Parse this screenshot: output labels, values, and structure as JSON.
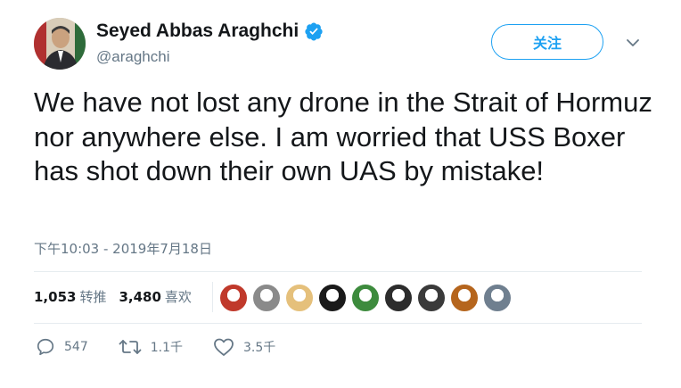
{
  "user": {
    "display_name": "Seyed Abbas Araghchi",
    "handle": "@araghchi",
    "verified": true
  },
  "header": {
    "follow_label": "关注"
  },
  "tweet": {
    "text": "We have not lost any drone in the Strait of Hormuz nor anywhere else. I am worried that USS Boxer has shot down their own UAS by mistake!",
    "timestamp": "下午10:03 - 2019年7月18日"
  },
  "stats": {
    "retweets_count": "1,053",
    "retweets_label": "转推",
    "likes_count": "3,480",
    "likes_label": "喜欢"
  },
  "actions": {
    "reply_count": "547",
    "retweet_count": "1.1千",
    "like_count": "3.5千"
  },
  "colors": {
    "accent": "#1da1f2",
    "secondary_text": "#657786",
    "divider": "#e6ecf0"
  },
  "likers": [
    {
      "name": "liker-avatar-1",
      "color": "#c0392b"
    },
    {
      "name": "liker-avatar-2",
      "color": "#8a8a8a"
    },
    {
      "name": "liker-avatar-3",
      "color": "#e5c07b"
    },
    {
      "name": "liker-avatar-4",
      "color": "#1a1a1a"
    },
    {
      "name": "liker-avatar-5",
      "color": "#3d8b3d"
    },
    {
      "name": "liker-avatar-6",
      "color": "#2c2c2c"
    },
    {
      "name": "liker-avatar-7",
      "color": "#3a3a3a"
    },
    {
      "name": "liker-avatar-8",
      "color": "#b5651d"
    },
    {
      "name": "liker-avatar-9",
      "color": "#6f7f8f"
    }
  ]
}
